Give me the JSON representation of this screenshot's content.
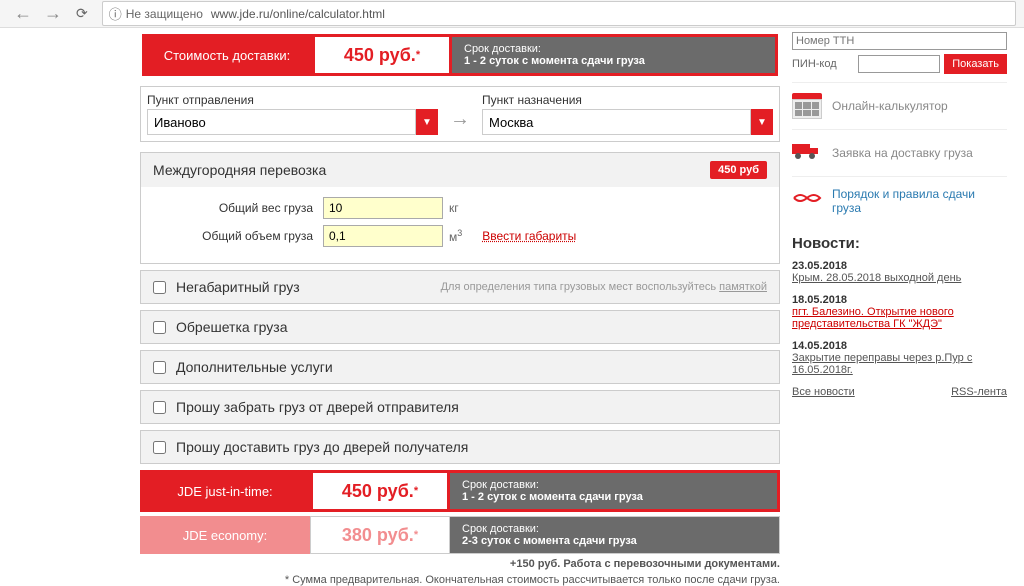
{
  "browser": {
    "insecure_label": "Не защищено",
    "url": "www.jde.ru/online/calculator.html"
  },
  "header": {
    "cost_label": "Стоимость доставки:",
    "cost_value": "450 руб.",
    "delivery_title": "Срок доставки:",
    "delivery_value": "1 - 2 суток с момента сдачи груза"
  },
  "route": {
    "from_label": "Пункт отправления",
    "from_value": "Иваново",
    "to_label": "Пункт назначения",
    "to_value": "Москва"
  },
  "intercity": {
    "title": "Междугородняя перевозка",
    "price_badge": "450 руб",
    "weight_label": "Общий вес груза",
    "weight_value": "10",
    "weight_unit": "кг",
    "volume_label": "Общий объем груза",
    "volume_value": "0,1",
    "volume_unit": "м",
    "dimensions_link": "Ввести габариты"
  },
  "panels": {
    "oversized": "Негабаритный груз",
    "oversized_hint": "Для определения типа грузовых мест воспользуйтесь",
    "oversized_hint_link": "памяткой",
    "crating": "Обрешетка груза",
    "additional": "Дополнительные услуги",
    "pickup": "Прошу забрать груз от дверей отправителя",
    "delivery": "Прошу доставить груз до дверей получателя"
  },
  "results": {
    "jit_label": "JDE just-in-time:",
    "jit_price": "450 руб.",
    "jit_time_title": "Срок доставки:",
    "jit_time_value": "1 - 2 суток с момента сдачи груза",
    "eco_label": "JDE economy:",
    "eco_price": "380 руб.",
    "eco_time_title": "Срок доставки:",
    "eco_time_value": "2-3 суток с момента сдачи груза"
  },
  "footnotes": {
    "surcharge": "+150 руб. Работа с перевозочными документами.",
    "disclaimer": "* Сумма предварительная. Окончательная стоимость рассчитывается только после сдачи груза."
  },
  "side": {
    "ttn_label": "Номер ТТН",
    "pin_label": "ПИН-код",
    "show_btn": "Показать",
    "calc_link": "Онлайн-калькулятор",
    "request_link": "Заявка на доставку груза",
    "rules_link": "Порядок и правила сдачи груза",
    "news_title": "Новости:",
    "news": [
      {
        "date": "23.05.2018",
        "title": "Крым. 28.05.2018 выходной день",
        "red": false
      },
      {
        "date": "18.05.2018",
        "title": "пгт. Балезино. Открытие нового представительства ГК \"ЖДЭ\"",
        "red": true
      },
      {
        "date": "14.05.2018",
        "title": "Закрытие переправы через р.Пур с 16.05.2018г.",
        "red": false
      }
    ],
    "all_news": "Все новости",
    "rss": "RSS-лента"
  }
}
